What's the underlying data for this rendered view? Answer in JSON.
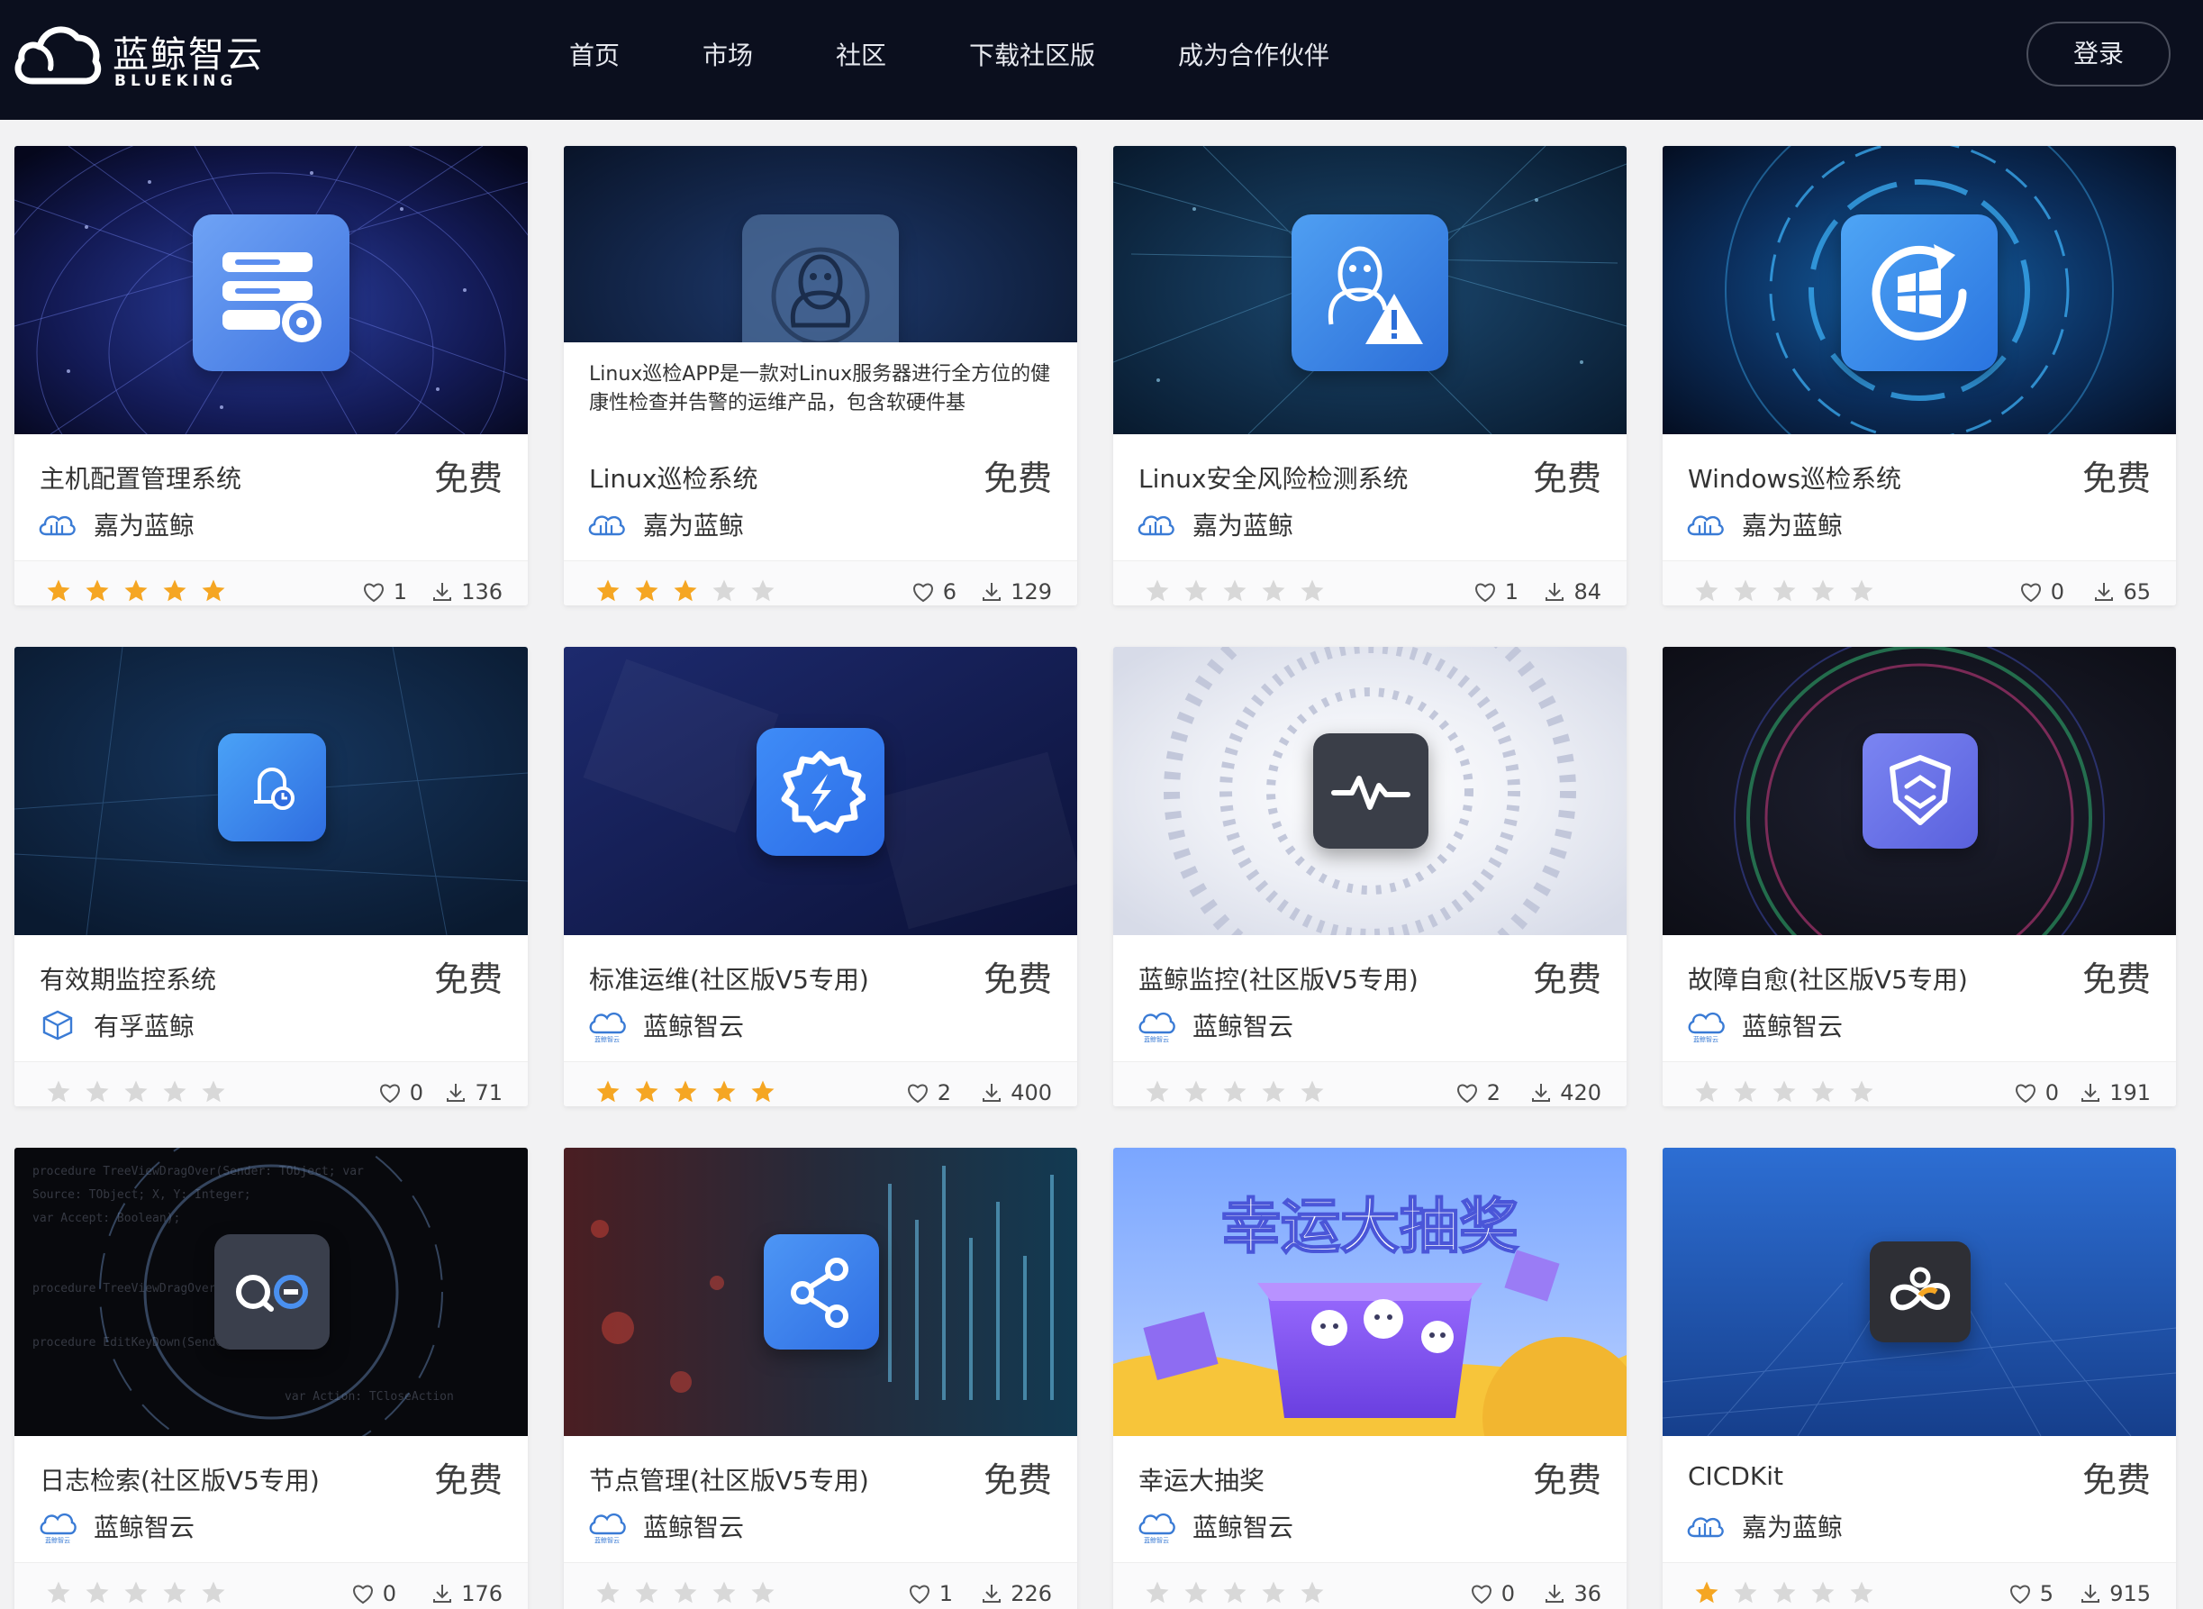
{
  "brand": {
    "name_cn": "蓝鲸智云",
    "name_en": "BLUEKING"
  },
  "nav": [
    {
      "label": "首页"
    },
    {
      "label": "市场"
    },
    {
      "label": "社区"
    },
    {
      "label": "下载社区版"
    },
    {
      "label": "成为合作伙伴"
    }
  ],
  "login_label": "登录",
  "colors": {
    "header_bg": "#0b0f1e",
    "star_on": "#f5a623",
    "star_off": "#d8d8d8",
    "page_bg": "#f2f2f3"
  },
  "apps": [
    {
      "title": "主机配置管理系统",
      "price": "免费",
      "publisher": "嘉为蓝鲸",
      "publisher_logo": "jiawei-logo",
      "icon": "server-settings-icon",
      "rating": 5,
      "likes": "1",
      "downloads": "136"
    },
    {
      "title": "Linux巡检系统",
      "price": "免费",
      "publisher": "嘉为蓝鲸",
      "publisher_logo": "jiawei-logo",
      "icon": "linux-penguin-icon",
      "rating": 3,
      "likes": "6",
      "downloads": "129",
      "description": "Linux巡检APP是一款对Linux服务器进行全方位的健康性检查并告警的运维产品，包含软硬件基"
    },
    {
      "title": "Linux安全风险检测系统",
      "price": "免费",
      "publisher": "嘉为蓝鲸",
      "publisher_logo": "jiawei-logo",
      "icon": "linux-warning-icon",
      "rating": 0,
      "likes": "1",
      "downloads": "84"
    },
    {
      "title": "Windows巡检系统",
      "price": "免费",
      "publisher": "嘉为蓝鲸",
      "publisher_logo": "jiawei-logo",
      "icon": "windows-refresh-icon",
      "rating": 0,
      "likes": "0",
      "downloads": "65"
    },
    {
      "title": "有效期监控系统",
      "price": "免费",
      "publisher": "有孚蓝鲸",
      "publisher_logo": "youfu-logo",
      "icon": "bell-clock-icon",
      "rating": 0,
      "likes": "0",
      "downloads": "71"
    },
    {
      "title": "标准运维(社区版V5专用)",
      "price": "免费",
      "publisher": "蓝鲸智云",
      "publisher_logo": "blueking-logo",
      "icon": "gear-bolt-icon",
      "rating": 5,
      "likes": "2",
      "downloads": "400"
    },
    {
      "title": "蓝鲸监控(社区版V5专用)",
      "price": "免费",
      "publisher": "蓝鲸智云",
      "publisher_logo": "blueking-logo",
      "icon": "pulse-icon",
      "rating": 0,
      "likes": "2",
      "downloads": "420"
    },
    {
      "title": "故障自愈(社区版V5专用)",
      "price": "免费",
      "publisher": "蓝鲸智云",
      "publisher_logo": "blueking-logo",
      "icon": "shield-heal-icon",
      "rating": 0,
      "likes": "0",
      "downloads": "191"
    },
    {
      "title": "日志检索(社区版V5专用)",
      "price": "免费",
      "publisher": "蓝鲸智云",
      "publisher_logo": "blueking-logo",
      "icon": "log-search-icon",
      "rating": 0,
      "likes": "0",
      "downloads": "176"
    },
    {
      "title": "节点管理(社区版V5专用)",
      "price": "免费",
      "publisher": "蓝鲸智云",
      "publisher_logo": "blueking-logo",
      "icon": "node-share-icon",
      "rating": 0,
      "likes": "1",
      "downloads": "226"
    },
    {
      "title": "幸运大抽奖",
      "price": "免费",
      "publisher": "蓝鲸智云",
      "publisher_logo": "blueking-logo",
      "icon": "lottery-banner",
      "banner_text": "幸运大抽奖",
      "rating": 0,
      "likes": "0",
      "downloads": "36"
    },
    {
      "title": "CICDKit",
      "price": "免费",
      "publisher": "嘉为蓝鲸",
      "publisher_logo": "jiawei-logo",
      "icon": "infinity-gear-icon",
      "rating": 1,
      "likes": "5",
      "downloads": "915"
    }
  ]
}
